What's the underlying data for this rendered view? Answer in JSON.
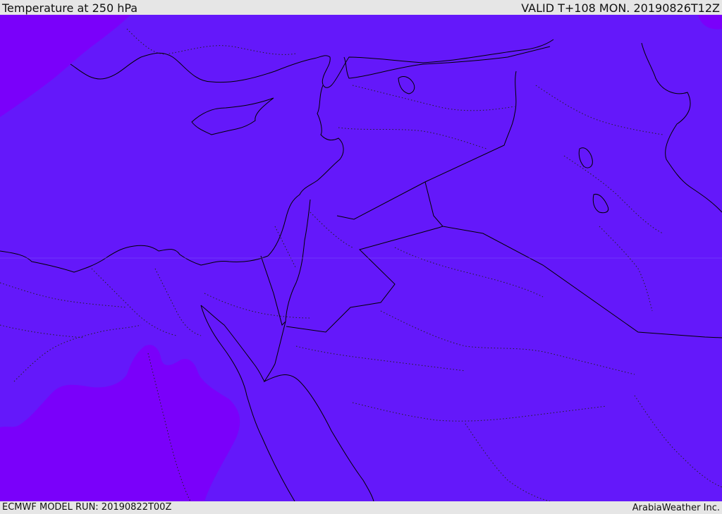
{
  "header": {
    "title": "Temperature at 250 hPa",
    "valid": "VALID T+108 MON. 20190826T12Z"
  },
  "footer": {
    "model_run": "ECMWF MODEL RUN: 20190822T00Z",
    "credit": "ArabiaWeather Inc."
  },
  "map": {
    "colors": {
      "base_fill": "#6418fa",
      "cold_fill": "#7a00fa",
      "coastline": "#000000",
      "border": "#000000"
    }
  }
}
